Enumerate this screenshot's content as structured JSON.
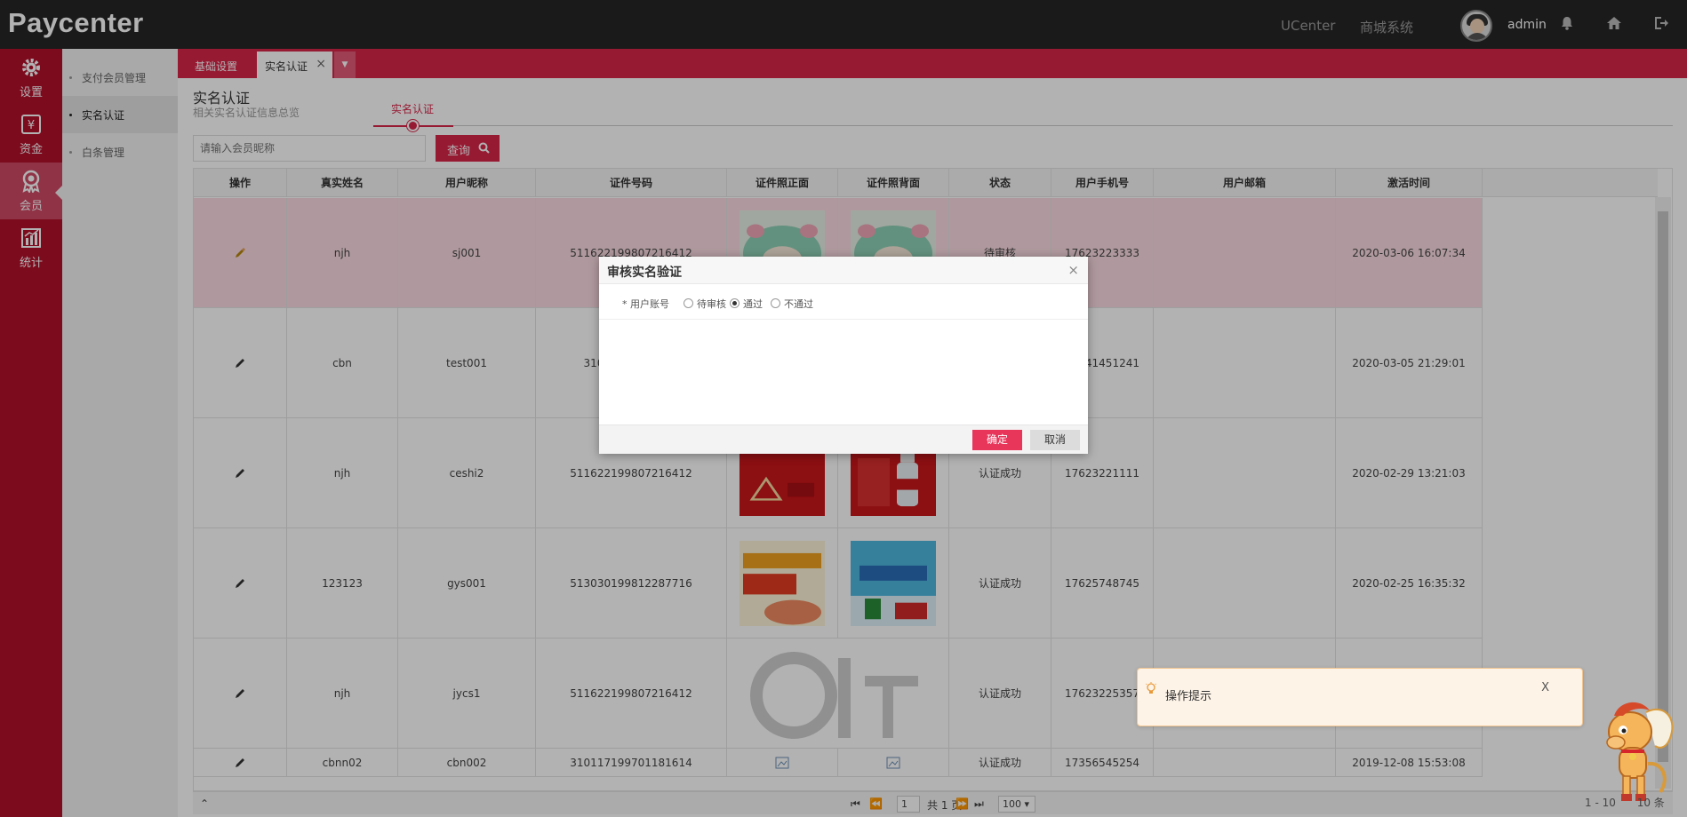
{
  "app": {
    "brand": "Paycenter",
    "nav_links": [
      "UCenter",
      "商城系统"
    ],
    "username": "admin"
  },
  "rail": [
    {
      "label": "设置",
      "icon": "gear-icon"
    },
    {
      "label": "资金",
      "icon": "yen-icon"
    },
    {
      "label": "会员",
      "icon": "member-badge-icon"
    },
    {
      "label": "统计",
      "icon": "bar-chart-icon"
    }
  ],
  "submenu": [
    {
      "label": "支付会员管理"
    },
    {
      "label": "实名认证"
    },
    {
      "label": "白条管理"
    }
  ],
  "tabs": [
    {
      "label": "基础设置"
    },
    {
      "label": "实名认证"
    }
  ],
  "page": {
    "title": "实名认证",
    "subtitle": "相关实名认证信息总览",
    "step_label": "实名认证"
  },
  "search": {
    "placeholder": "请输入会员昵称",
    "button": "查询"
  },
  "table": {
    "headers": [
      "操作",
      "真实姓名",
      "用户昵称",
      "证件号码",
      "证件照正面",
      "证件照背面",
      "状态",
      "用户手机号",
      "用户邮箱",
      "激活时间"
    ],
    "rows": [
      {
        "name": "njh",
        "nick": "sj001",
        "id": "511622199807216412",
        "status": "待审核",
        "phone": "17623223333",
        "email": "",
        "time": "2020-03-06 16:07:34"
      },
      {
        "name": "cbn",
        "nick": "test001",
        "id": "31011719970118",
        "status": "",
        "phone": "17341451241",
        "email": "",
        "time": "2020-03-05 21:29:01"
      },
      {
        "name": "njh",
        "nick": "ceshi2",
        "id": "511622199807216412",
        "status": "认证成功",
        "phone": "17623221111",
        "email": "",
        "time": "2020-02-29 13:21:03"
      },
      {
        "name": "123123",
        "nick": "gys001",
        "id": "513030199812287716",
        "status": "认证成功",
        "phone": "17625748745",
        "email": "",
        "time": "2020-02-25 16:35:32"
      },
      {
        "name": "njh",
        "nick": "jycs1",
        "id": "511622199807216412",
        "status": "认证成功",
        "phone": "17623225357",
        "email": "",
        "time": ""
      },
      {
        "name": "cbnn02",
        "nick": "cbn002",
        "id": "310117199701181614",
        "status": "认证成功",
        "phone": "17356545254",
        "email": "",
        "time": "2019-12-08 15:53:08"
      }
    ]
  },
  "pager": {
    "page": "1",
    "total_pages": "共 1 页",
    "page_size": "100 ▾",
    "range": "1 - 10",
    "count": "10 条"
  },
  "modal": {
    "title": "审核实名验证",
    "field_label": "* 用户账号",
    "options": [
      "待审核",
      "通过",
      "不通过"
    ],
    "selected": "通过",
    "ok": "确定",
    "cancel": "取消"
  },
  "toast": {
    "text": "操作提示",
    "close": "X"
  },
  "colors": {
    "brand_red": "#b3102b",
    "tab_red": "#d8264a",
    "ok_button": "#e8355a",
    "topbar": "#262626"
  }
}
